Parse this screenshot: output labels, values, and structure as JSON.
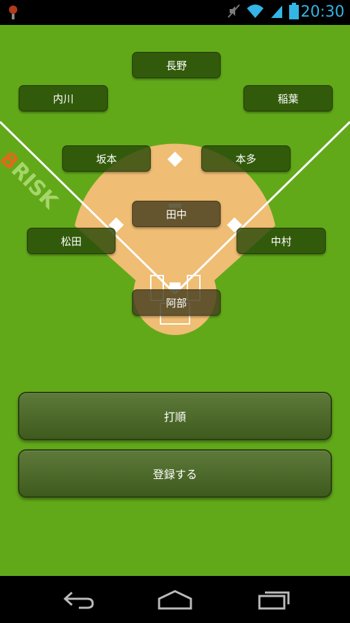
{
  "status_bar": {
    "time": "20:30",
    "icons": [
      "app-notification-icon",
      "mute-icon",
      "wifi-icon",
      "signal-icon",
      "battery-icon"
    ]
  },
  "watermark": {
    "text": "BRISK",
    "first_letter_color": "#e06a1a"
  },
  "positions": {
    "center_field": "長野",
    "left_field": "内川",
    "right_field": "稲葉",
    "shortstop": "坂本",
    "second_base": "本多",
    "pitcher": "田中",
    "third_base": "松田",
    "first_base": "中村",
    "catcher": "阿部"
  },
  "buttons": {
    "batting_order": "打順",
    "register": "登録する"
  },
  "nav_bar": {
    "icons": [
      "back-icon",
      "home-icon",
      "recent-apps-icon"
    ]
  },
  "colors": {
    "field_green": "#62a91a",
    "infield_dirt": "#efbd73",
    "status_time": "#33b5e5"
  }
}
